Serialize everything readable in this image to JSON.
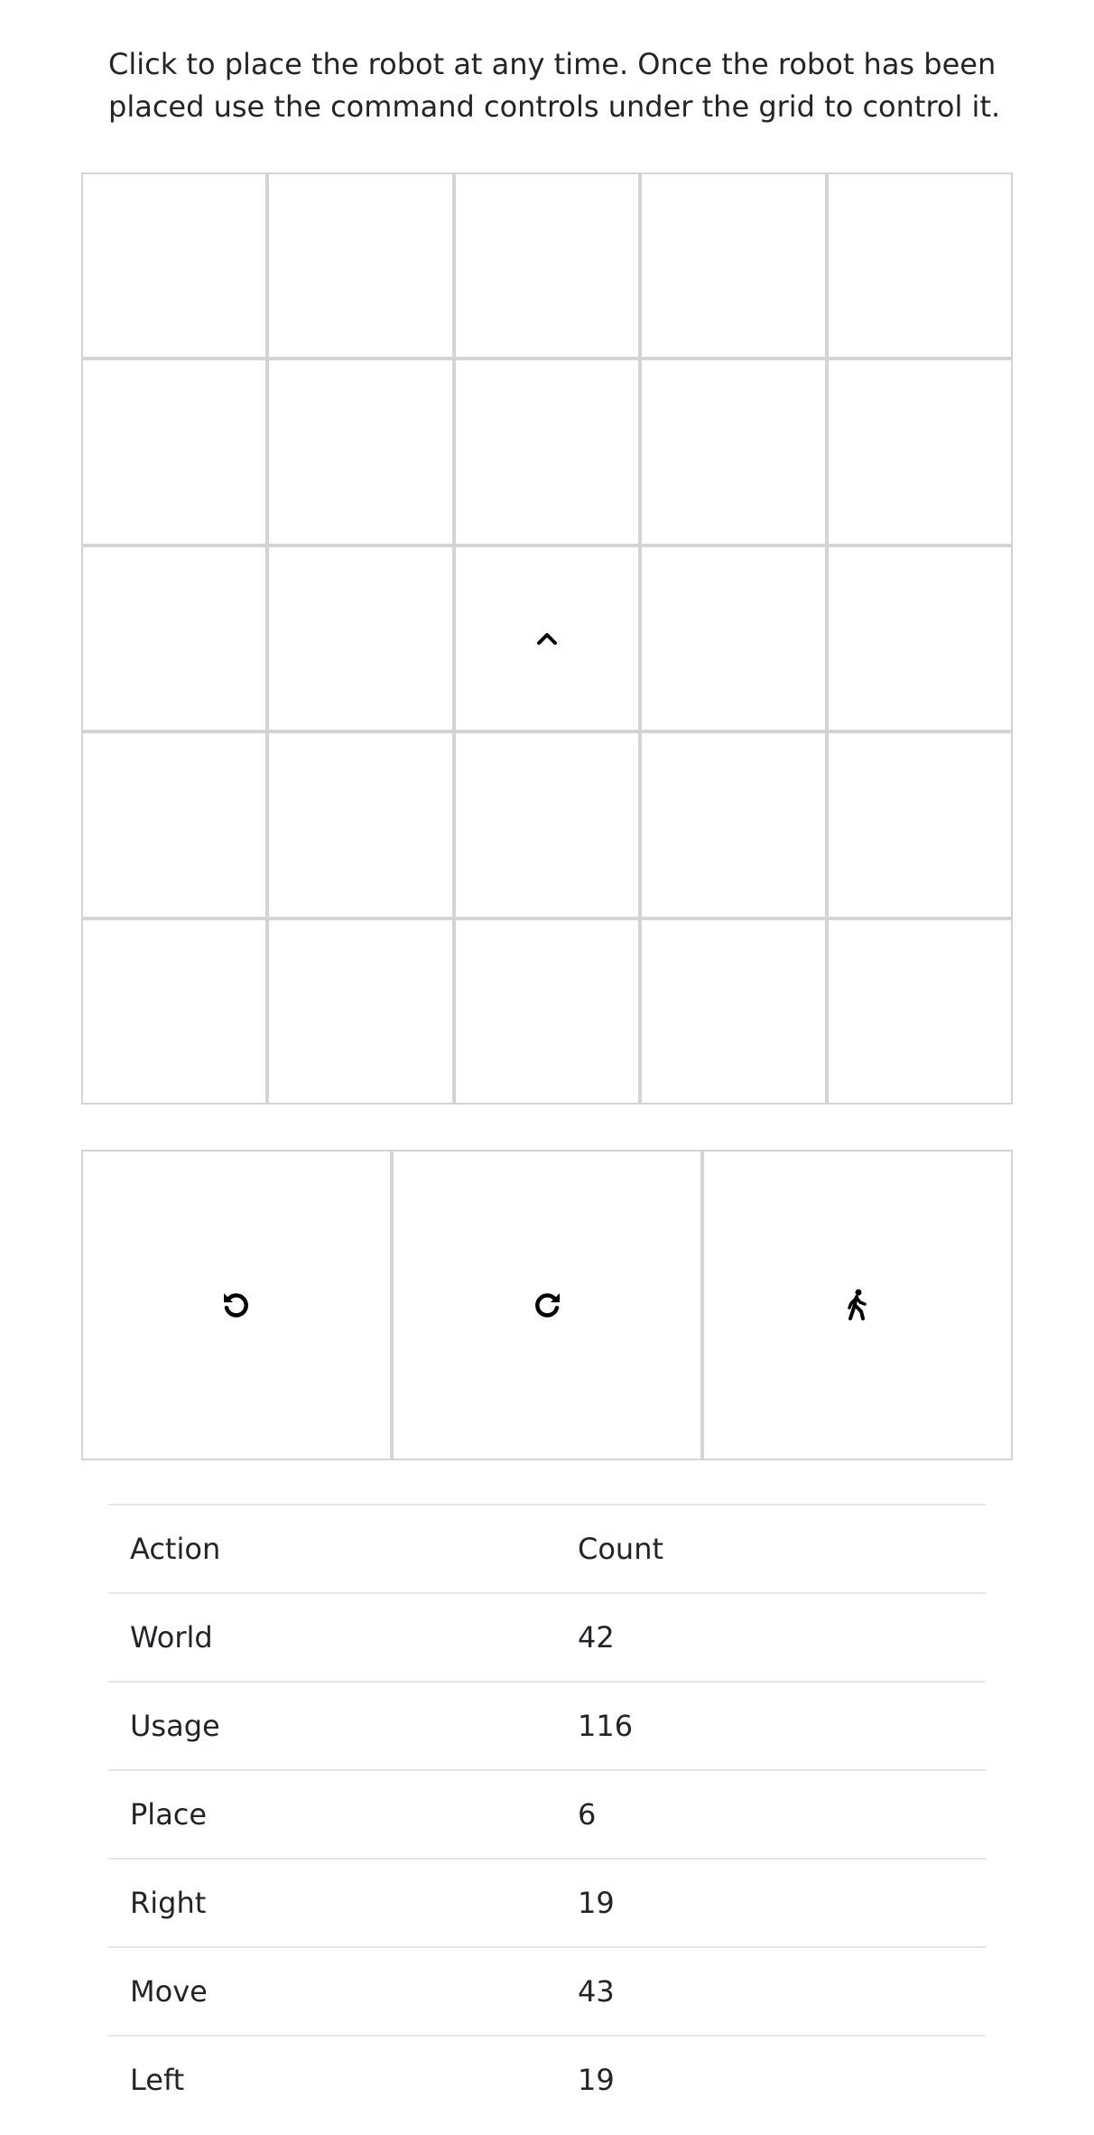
{
  "instructions": "Click to place the robot at any time. Once the robot has been placed use the command controls under the grid to control it.",
  "grid": {
    "rows": 5,
    "cols": 5,
    "robot": {
      "row": 3,
      "col": 3,
      "facing": "north",
      "icon": "chevron-up-icon"
    }
  },
  "controls": [
    {
      "name": "rotate-left-button",
      "icon": "rotate-left-icon"
    },
    {
      "name": "rotate-right-button",
      "icon": "rotate-right-icon"
    },
    {
      "name": "move-button",
      "icon": "walk-icon"
    }
  ],
  "stats": {
    "headers": {
      "action": "Action",
      "count": "Count"
    },
    "rows": [
      {
        "action": "World",
        "count": "42"
      },
      {
        "action": "Usage",
        "count": "116"
      },
      {
        "action": "Place",
        "count": "6"
      },
      {
        "action": "Right",
        "count": "19"
      },
      {
        "action": "Move",
        "count": "43"
      },
      {
        "action": "Left",
        "count": "19"
      }
    ]
  }
}
